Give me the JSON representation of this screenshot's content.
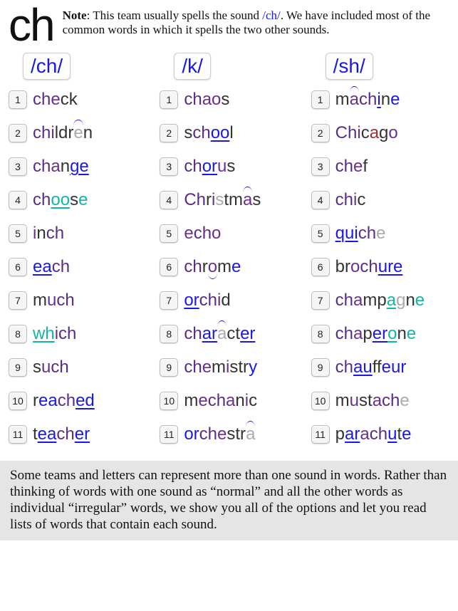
{
  "header": {
    "digraph": "ch",
    "note_bold": "Note",
    "note_text1": ": This team usually spells the sound ",
    "note_sound": "/ch/",
    "note_text2": ".  We have included most of the common words in which it spells the two other sounds."
  },
  "columns": [
    {
      "header": "/ch/",
      "words": [
        {
          "n": "1",
          "segs": [
            {
              "t": "ch",
              "c": "c-n"
            },
            {
              "t": "e",
              "c": "c-p"
            },
            {
              "t": "ck",
              "c": "c-d"
            }
          ]
        },
        {
          "n": "2",
          "segs": [
            {
              "t": "ch",
              "c": "c-n"
            },
            {
              "t": "i",
              "c": "c-p"
            },
            {
              "t": "ldr",
              "c": "c-d"
            },
            {
              "t": "e",
              "c": "c-g",
              "d": "arc-over"
            },
            {
              "t": "n",
              "c": "c-d"
            }
          ]
        },
        {
          "n": "3",
          "segs": [
            {
              "t": "ch",
              "c": "c-n"
            },
            {
              "t": "a",
              "c": "c-p"
            },
            {
              "t": "n",
              "c": "c-d"
            },
            {
              "t": "ge",
              "c": "c-b",
              "d": "ul"
            }
          ]
        },
        {
          "n": "4",
          "segs": [
            {
              "t": "ch",
              "c": "c-n"
            },
            {
              "t": "oo",
              "c": "c-t",
              "d": "ult"
            },
            {
              "t": "s",
              "c": "c-d"
            },
            {
              "t": "e",
              "c": "c-t"
            }
          ]
        },
        {
          "n": "5",
          "segs": [
            {
              "t": "i",
              "c": "c-p"
            },
            {
              "t": "n",
              "c": "c-d"
            },
            {
              "t": "ch",
              "c": "c-n"
            }
          ]
        },
        {
          "n": "6",
          "segs": [
            {
              "t": "ea",
              "c": "c-b",
              "d": "ul"
            },
            {
              "t": "ch",
              "c": "c-n"
            }
          ]
        },
        {
          "n": "7",
          "segs": [
            {
              "t": "m",
              "c": "c-d"
            },
            {
              "t": "u",
              "c": "c-p"
            },
            {
              "t": "ch",
              "c": "c-n"
            }
          ]
        },
        {
          "n": "8",
          "segs": [
            {
              "t": "wh",
              "c": "c-t",
              "d": "ult"
            },
            {
              "t": "i",
              "c": "c-p"
            },
            {
              "t": "ch",
              "c": "c-n"
            }
          ]
        },
        {
          "n": "9",
          "segs": [
            {
              "t": "s",
              "c": "c-d"
            },
            {
              "t": "u",
              "c": "c-p"
            },
            {
              "t": "ch",
              "c": "c-n"
            }
          ]
        },
        {
          "n": "10",
          "segs": [
            {
              "t": "r",
              "c": "c-d"
            },
            {
              "t": "ea",
              "c": "c-b"
            },
            {
              "t": "ch",
              "c": "c-n"
            },
            {
              "t": "ed",
              "c": "c-b",
              "d": "ul"
            }
          ]
        },
        {
          "n": "11",
          "segs": [
            {
              "t": "t",
              "c": "c-d"
            },
            {
              "t": "ea",
              "c": "c-b",
              "d": "ul"
            },
            {
              "t": "ch",
              "c": "c-n"
            },
            {
              "t": "er",
              "c": "c-b",
              "d": "ul"
            }
          ]
        }
      ]
    },
    {
      "header": "/k/",
      "words": [
        {
          "n": "1",
          "segs": [
            {
              "t": "ch",
              "c": "c-n"
            },
            {
              "t": "a",
              "c": "c-p"
            },
            {
              "t": "o",
              "c": "c-p"
            },
            {
              "t": "s",
              "c": "c-d"
            }
          ]
        },
        {
          "n": "2",
          "segs": [
            {
              "t": "s",
              "c": "c-d"
            },
            {
              "t": "ch",
              "c": "c-n"
            },
            {
              "t": "oo",
              "c": "c-b",
              "d": "ul"
            },
            {
              "t": "l",
              "c": "c-d"
            }
          ]
        },
        {
          "n": "3",
          "segs": [
            {
              "t": "ch",
              "c": "c-n"
            },
            {
              "t": "or",
              "c": "c-b",
              "d": "ul"
            },
            {
              "t": "u",
              "c": "c-p"
            },
            {
              "t": "s",
              "c": "c-d"
            }
          ]
        },
        {
          "n": "4",
          "segs": [
            {
              "t": "Ch",
              "c": "c-n"
            },
            {
              "t": "r",
              "c": "c-d"
            },
            {
              "t": "i",
              "c": "c-p"
            },
            {
              "t": "s",
              "c": "c-g"
            },
            {
              "t": "tm",
              "c": "c-d"
            },
            {
              "t": "a",
              "c": "c-p",
              "d": "arc-over"
            },
            {
              "t": "s",
              "c": "c-d"
            }
          ]
        },
        {
          "n": "5",
          "segs": [
            {
              "t": "e",
              "c": "c-p"
            },
            {
              "t": "ch",
              "c": "c-n"
            },
            {
              "t": "o",
              "c": "c-p"
            }
          ]
        },
        {
          "n": "6",
          "segs": [
            {
              "t": "ch",
              "c": "c-n"
            },
            {
              "t": "r",
              "c": "c-d"
            },
            {
              "t": "o",
              "c": "c-p",
              "d": "arc-under"
            },
            {
              "t": "m",
              "c": "c-d"
            },
            {
              "t": "e",
              "c": "c-b"
            }
          ]
        },
        {
          "n": "7",
          "segs": [
            {
              "t": "or",
              "c": "c-b",
              "d": "ul"
            },
            {
              "t": "ch",
              "c": "c-n"
            },
            {
              "t": "i",
              "c": "c-p"
            },
            {
              "t": "d",
              "c": "c-d"
            }
          ]
        },
        {
          "n": "8",
          "segs": [
            {
              "t": "ch",
              "c": "c-n"
            },
            {
              "t": "ar",
              "c": "c-b",
              "d": "ul"
            },
            {
              "t": "a",
              "c": "c-g",
              "d": "arc-over"
            },
            {
              "t": "ct",
              "c": "c-d"
            },
            {
              "t": "er",
              "c": "c-b",
              "d": "ul"
            }
          ]
        },
        {
          "n": "9",
          "segs": [
            {
              "t": "ch",
              "c": "c-n"
            },
            {
              "t": "e",
              "c": "c-p"
            },
            {
              "t": "m",
              "c": "c-d"
            },
            {
              "t": "i",
              "c": "c-p"
            },
            {
              "t": "str",
              "c": "c-d"
            },
            {
              "t": "y",
              "c": "c-b"
            }
          ]
        },
        {
          "n": "10",
          "segs": [
            {
              "t": "m",
              "c": "c-d"
            },
            {
              "t": "e",
              "c": "c-p"
            },
            {
              "t": "ch",
              "c": "c-n"
            },
            {
              "t": "a",
              "c": "c-p"
            },
            {
              "t": "n",
              "c": "c-d"
            },
            {
              "t": "i",
              "c": "c-p"
            },
            {
              "t": "c",
              "c": "c-d"
            }
          ]
        },
        {
          "n": "11",
          "segs": [
            {
              "t": "or",
              "c": "c-b"
            },
            {
              "t": "ch",
              "c": "c-n"
            },
            {
              "t": "e",
              "c": "c-p"
            },
            {
              "t": "str",
              "c": "c-d"
            },
            {
              "t": "a",
              "c": "c-g",
              "d": "arc-over"
            }
          ]
        }
      ]
    },
    {
      "header": "/sh/",
      "words": [
        {
          "n": "1",
          "segs": [
            {
              "t": "m",
              "c": "c-d"
            },
            {
              "t": "a",
              "c": "c-p",
              "d": "arc-over"
            },
            {
              "t": "ch",
              "c": "c-n"
            },
            {
              "t": "i",
              "c": "c-b",
              "d": "ul"
            },
            {
              "t": "n",
              "c": "c-d"
            },
            {
              "t": "e",
              "c": "c-b"
            }
          ]
        },
        {
          "n": "2",
          "segs": [
            {
              "t": "Ch",
              "c": "c-n"
            },
            {
              "t": "i",
              "c": "c-p"
            },
            {
              "t": "c",
              "c": "c-d"
            },
            {
              "t": "a",
              "c": "c-r"
            },
            {
              "t": "g",
              "c": "c-d"
            },
            {
              "t": "o",
              "c": "c-p"
            }
          ]
        },
        {
          "n": "3",
          "segs": [
            {
              "t": "ch",
              "c": "c-n"
            },
            {
              "t": "e",
              "c": "c-p"
            },
            {
              "t": "f",
              "c": "c-d"
            }
          ]
        },
        {
          "n": "4",
          "segs": [
            {
              "t": "ch",
              "c": "c-n"
            },
            {
              "t": "i",
              "c": "c-p"
            },
            {
              "t": "c",
              "c": "c-d"
            }
          ]
        },
        {
          "n": "5",
          "segs": [
            {
              "t": "qu",
              "c": "c-b",
              "d": "ul"
            },
            {
              "t": "i",
              "c": "c-b",
              "d": "ul"
            },
            {
              "t": "ch",
              "c": "c-n"
            },
            {
              "t": "e",
              "c": "c-g"
            }
          ]
        },
        {
          "n": "6",
          "segs": [
            {
              "t": "br",
              "c": "c-d"
            },
            {
              "t": "o",
              "c": "c-p"
            },
            {
              "t": "ch",
              "c": "c-n"
            },
            {
              "t": "ure",
              "c": "c-b",
              "d": "ul"
            }
          ]
        },
        {
          "n": "7",
          "segs": [
            {
              "t": "ch",
              "c": "c-n"
            },
            {
              "t": "a",
              "c": "c-p"
            },
            {
              "t": "mp",
              "c": "c-d"
            },
            {
              "t": "a",
              "c": "c-t",
              "d": "ult"
            },
            {
              "t": "g",
              "c": "c-g"
            },
            {
              "t": "n",
              "c": "c-d"
            },
            {
              "t": "e",
              "c": "c-t"
            }
          ]
        },
        {
          "n": "8",
          "segs": [
            {
              "t": "ch",
              "c": "c-n"
            },
            {
              "t": "a",
              "c": "c-p"
            },
            {
              "t": "p",
              "c": "c-d"
            },
            {
              "t": "er",
              "c": "c-b",
              "d": "ul"
            },
            {
              "t": "o",
              "c": "c-t",
              "d": "ult"
            },
            {
              "t": "n",
              "c": "c-d"
            },
            {
              "t": "e",
              "c": "c-t"
            }
          ]
        },
        {
          "n": "9",
          "segs": [
            {
              "t": "ch",
              "c": "c-n"
            },
            {
              "t": "au",
              "c": "c-b",
              "d": "ul"
            },
            {
              "t": "ff",
              "c": "c-d"
            },
            {
              "t": "eur",
              "c": "c-b"
            }
          ]
        },
        {
          "n": "10",
          "segs": [
            {
              "t": "m",
              "c": "c-d"
            },
            {
              "t": "u",
              "c": "c-p"
            },
            {
              "t": "st",
              "c": "c-d"
            },
            {
              "t": "a",
              "c": "c-p"
            },
            {
              "t": "ch",
              "c": "c-n"
            },
            {
              "t": "e",
              "c": "c-g"
            }
          ]
        },
        {
          "n": "11",
          "segs": [
            {
              "t": "p",
              "c": "c-d"
            },
            {
              "t": "ar",
              "c": "c-b",
              "d": "ul"
            },
            {
              "t": "a",
              "c": "c-p"
            },
            {
              "t": "ch",
              "c": "c-n"
            },
            {
              "t": "u",
              "c": "c-b",
              "d": "ul"
            },
            {
              "t": "t",
              "c": "c-d"
            },
            {
              "t": "e",
              "c": "c-b"
            }
          ]
        }
      ]
    }
  ],
  "footer": "Some teams and letters can represent more than one sound in words. Rather than thinking of words with one sound as “normal” and all the other words as individual “irregular” words, we show you all of the options and let you read lists of words that contain each sound."
}
